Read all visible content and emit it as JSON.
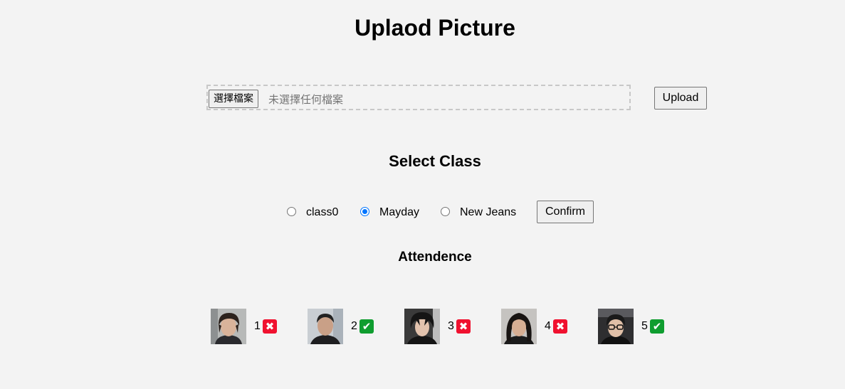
{
  "header": {
    "title": "Uplaod Picture"
  },
  "upload": {
    "choose_file_label": "選擇檔案",
    "file_status": "未選擇任何檔案",
    "upload_button": "Upload"
  },
  "class_select": {
    "title": "Select Class",
    "options": [
      {
        "label": "class0",
        "checked": false
      },
      {
        "label": "Mayday",
        "checked": true
      },
      {
        "label": "New Jeans",
        "checked": false
      }
    ],
    "confirm_button": "Confirm"
  },
  "attendance": {
    "title": "Attendence",
    "students": [
      {
        "number": "1",
        "status": "absent",
        "mark": "✖"
      },
      {
        "number": "2",
        "status": "present",
        "mark": "✔"
      },
      {
        "number": "3",
        "status": "absent",
        "mark": "✖"
      },
      {
        "number": "4",
        "status": "absent",
        "mark": "✖"
      },
      {
        "number": "5",
        "status": "present",
        "mark": "✔"
      }
    ]
  },
  "colors": {
    "background": "#f3f3f3",
    "radio_accent": "#0075ff",
    "absent": "#f0112f",
    "present": "#0f9d2f"
  }
}
